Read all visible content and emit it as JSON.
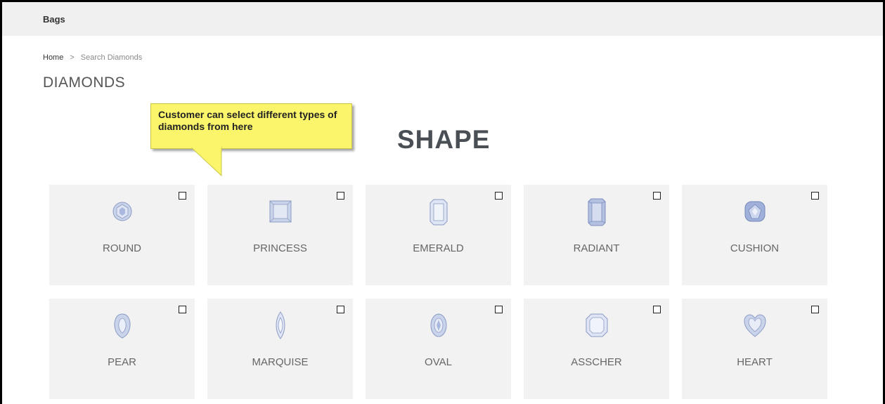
{
  "topbar": {
    "category": "Bags"
  },
  "breadcrumb": {
    "home": "Home",
    "separator": ">",
    "current": "Search Diamonds"
  },
  "page_title": "DIAMONDS",
  "callout": {
    "text": "Customer can select different types of diamonds from here"
  },
  "section_title": "SHAPE",
  "shapes": [
    {
      "label": "ROUND",
      "icon": "round-diamond-icon",
      "checked": false
    },
    {
      "label": "PRINCESS",
      "icon": "princess-diamond-icon",
      "checked": false
    },
    {
      "label": "EMERALD",
      "icon": "emerald-diamond-icon",
      "checked": false
    },
    {
      "label": "RADIANT",
      "icon": "radiant-diamond-icon",
      "checked": false
    },
    {
      "label": "CUSHION",
      "icon": "cushion-diamond-icon",
      "checked": false
    },
    {
      "label": "PEAR",
      "icon": "pear-diamond-icon",
      "checked": false
    },
    {
      "label": "MARQUISE",
      "icon": "marquise-diamond-icon",
      "checked": false
    },
    {
      "label": "OVAL",
      "icon": "oval-diamond-icon",
      "checked": false
    },
    {
      "label": "ASSCHER",
      "icon": "asscher-diamond-icon",
      "checked": false
    },
    {
      "label": "HEART",
      "icon": "heart-diamond-icon",
      "checked": false
    }
  ],
  "colors": {
    "gem_fill": "#c9d3ea",
    "gem_stroke": "#8b9bc4",
    "tile_bg": "#f2f2f2",
    "callout_bg": "#fbf56b"
  }
}
